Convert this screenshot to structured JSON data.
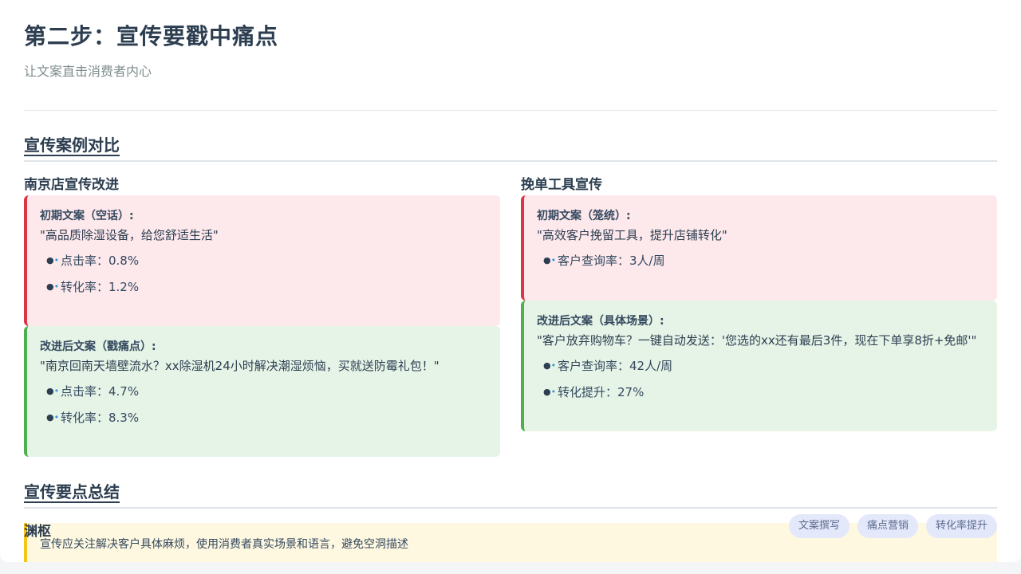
{
  "header": {
    "title": "第二步：宣传要戳中痛点",
    "subtitle": "让文案直击消费者内心"
  },
  "section1": {
    "heading": "宣传案例对比"
  },
  "left": {
    "title": "南京店宣传改进",
    "before": {
      "label": "初期文案（空话）:",
      "quote": "\"高品质除湿设备，给您舒适生活\"",
      "metrics": [
        "点击率：0.8%",
        "转化率：1.2%"
      ]
    },
    "after": {
      "label": "改进后文案（戳痛点）:",
      "quote": "\"南京回南天墙壁流水？xx除湿机24小时解决潮湿烦恼，买就送防霉礼包！\"",
      "metrics": [
        "点击率：4.7%",
        "转化率：8.3%"
      ]
    }
  },
  "right": {
    "title": "挽单工具宣传",
    "before": {
      "label": "初期文案（笼统）:",
      "quote": "\"高效客户挽留工具，提升店铺转化\"",
      "metrics": [
        "客户查询率：3人/周"
      ]
    },
    "after": {
      "label": "改进后文案（具体场景）:",
      "quote": "\"客户放弃购物车？一键自动发送：'您选的xx还有最后3件，现在下单享8折+免邮'\"",
      "metrics": [
        "客户查询率：42人/周",
        "转化提升：27%"
      ]
    }
  },
  "section2": {
    "heading": "宣传要点总结"
  },
  "summary": {
    "title": "渊枢",
    "text": "宣传应关注解决客户具体麻烦，使用消费者真实场景和语言，避免空洞描述"
  },
  "tags": [
    "文案撰写",
    "痛点营销",
    "转化率提升"
  ],
  "colors": {
    "bad_bg": "#fde8ec",
    "bad_border": "#dc3545",
    "good_bg": "#e6f4e7",
    "good_border": "#4caf50",
    "summary_bg": "#fff8e1",
    "summary_border": "#f5c518",
    "tag_bg": "#e3e8fb"
  },
  "icons": {
    "bullet": "bullet-icon"
  }
}
